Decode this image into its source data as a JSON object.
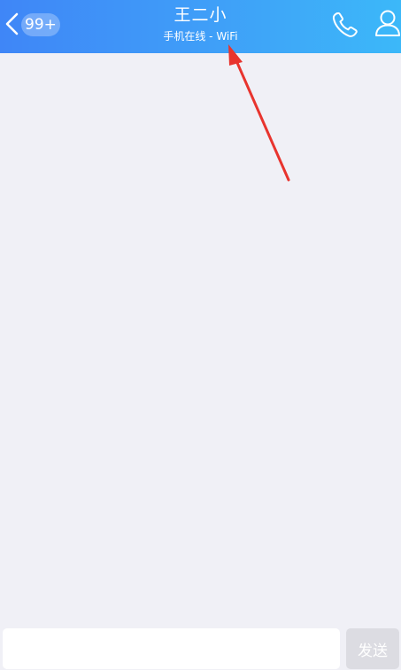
{
  "header": {
    "back_badge": "99+",
    "contact_name": "王二小",
    "status": "手机在线 - WiFi",
    "call_icon": "phone-icon",
    "profile_icon": "person-icon",
    "back_icon": "chevron-left-icon"
  },
  "composer": {
    "input_value": "",
    "input_placeholder": "",
    "send_label": "发送"
  },
  "annotation": {
    "type": "red-arrow",
    "color": "#e8342e",
    "points_to": "header.status"
  },
  "colors": {
    "header_gradient_start": "#3f86f7",
    "header_gradient_end": "#3cb8f9",
    "background": "#f0f0f6",
    "send_button_disabled": "#dcdce2"
  }
}
